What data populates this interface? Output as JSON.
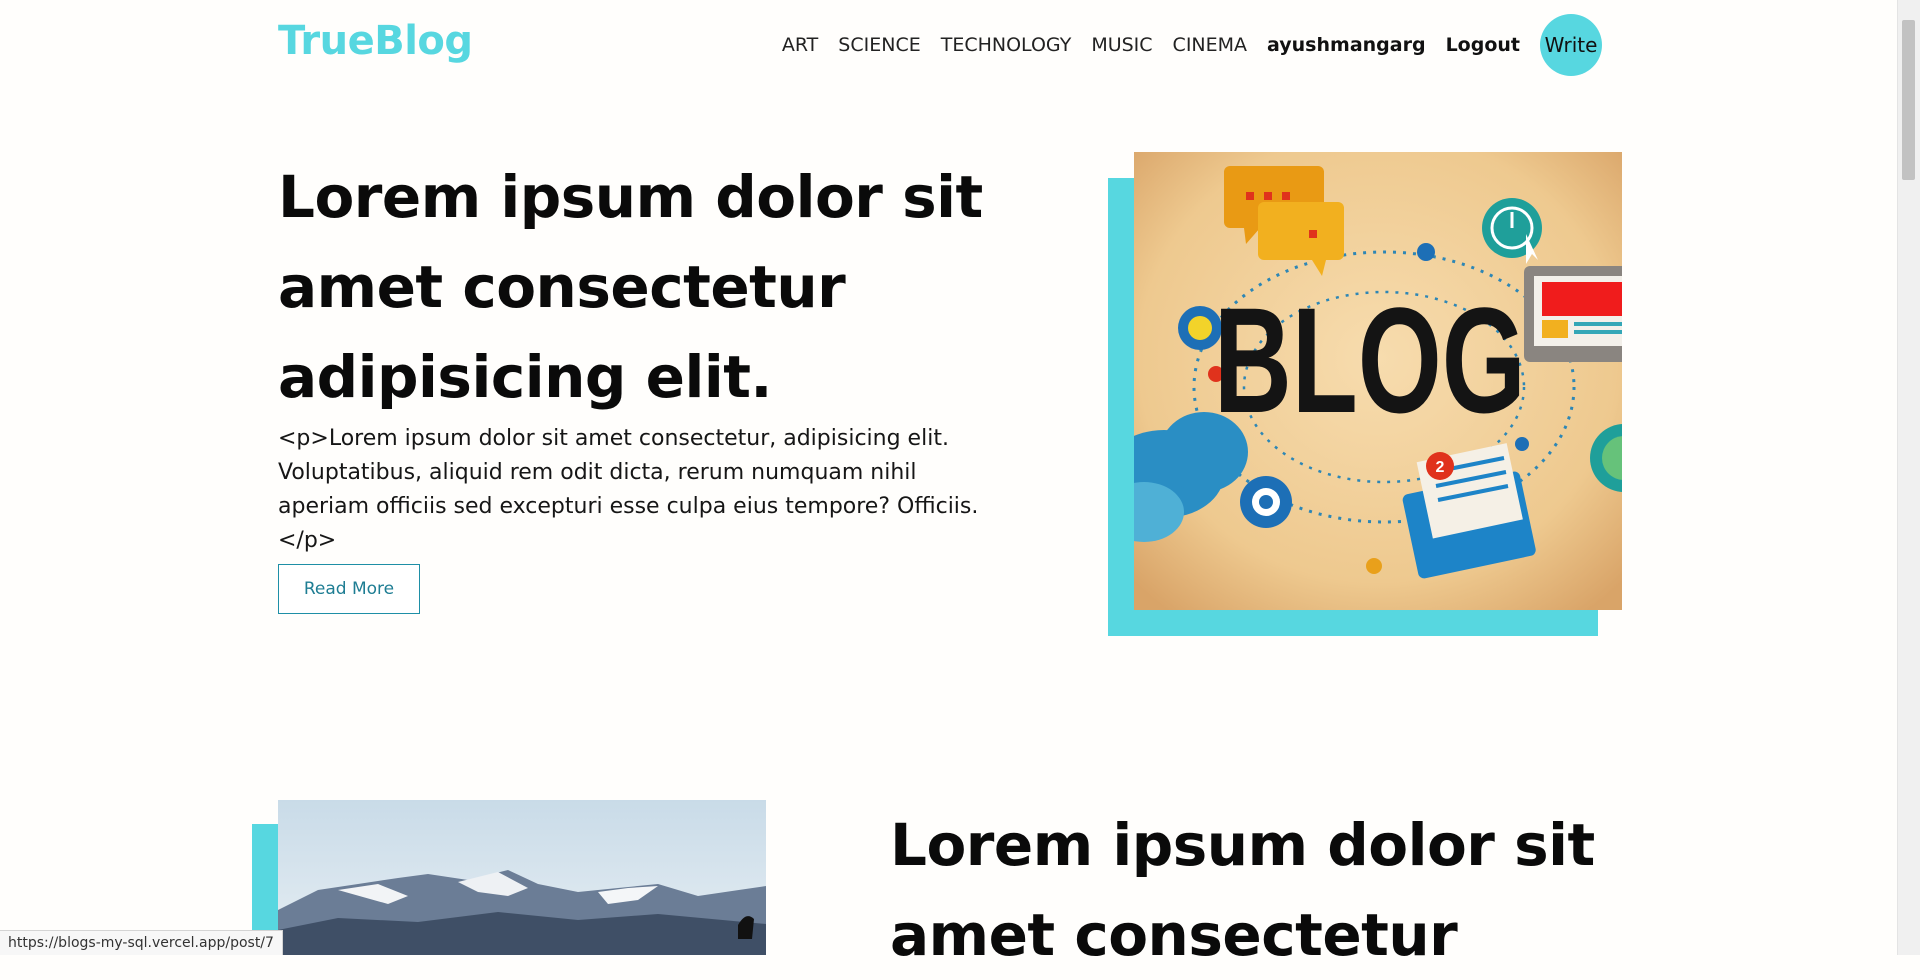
{
  "navbar": {
    "logo": "TrueBlog",
    "links": [
      "ART",
      "SCIENCE",
      "TECHNOLOGY",
      "MUSIC",
      "CINEMA"
    ],
    "username": "ayushmangarg",
    "logout": "Logout",
    "write": "Write"
  },
  "posts": [
    {
      "title": "Lorem ipsum dolor sit amet consectetur adipisicing elit.",
      "description": "<p>Lorem ipsum dolor sit amet consectetur, adipisicing elit. Voluptatibus, aliquid rem odit dicta, rerum numquam nihil aperiam officiis sed excepturi esse culpa eius tempore? Officiis.</p>",
      "read_more": "Read More",
      "image_text": "BLOG"
    },
    {
      "title": "Lorem ipsum dolor sit amet consectetur"
    }
  ],
  "status_bar": {
    "url": "https://blogs-my-sql.vercel.app/post/7"
  },
  "colors": {
    "accent": "#57d7e0",
    "button_border": "#1e8fa6"
  }
}
